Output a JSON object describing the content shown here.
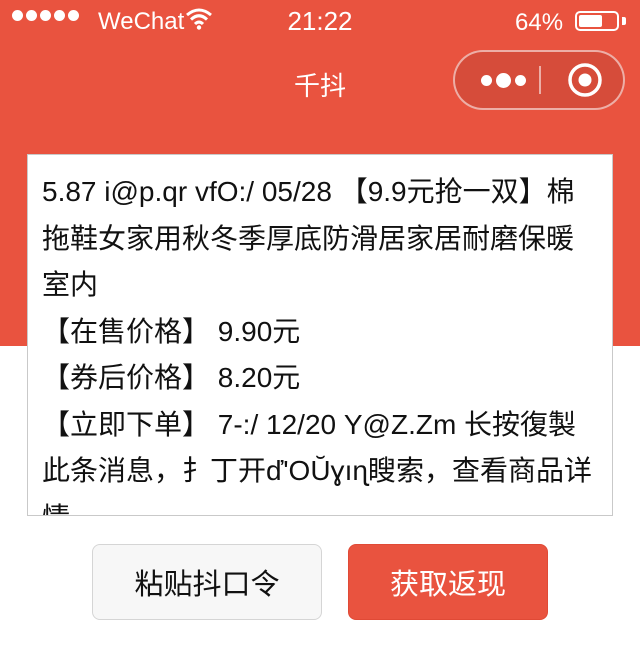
{
  "status_bar": {
    "carrier": "WeChat",
    "time": "21:22",
    "battery_percent_label": "64%",
    "battery_level": 0.64
  },
  "nav": {
    "title": "千抖",
    "more_icon": "more-dots-icon",
    "close_icon": "target-circle-icon"
  },
  "content": {
    "text": "5.87 i@p.qr vfO:/ 05/28 【9.9元抢一双】棉拖鞋女家用秋冬季厚底防滑居家居耐磨保暖室内\n【在售价格】 9.90元\n【券后价格】 8.20元\n【立即下单】 7-:/ 12/20 Y@Z.Zm 长按復製此条消息，扌丁开ď'OŬɣıɳ瞍索，查看商品详情"
  },
  "actions": {
    "paste_label": "粘贴抖口令",
    "get_label": "获取返现"
  },
  "colors": {
    "brand_red": "#e9533f",
    "white": "#ffffff",
    "paste_button_bg": "#f7f7f7"
  }
}
